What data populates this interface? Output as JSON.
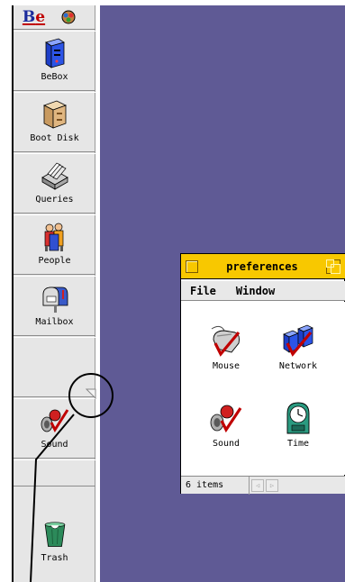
{
  "deskbar": {
    "be_menu": {
      "b": "B",
      "e": "e"
    },
    "items": [
      {
        "label": "BeBox",
        "icon": "bebox-icon"
      },
      {
        "label": "Boot Disk",
        "icon": "boot-disk-icon"
      },
      {
        "label": "Queries",
        "icon": "queries-icon"
      },
      {
        "label": "People",
        "icon": "people-icon"
      },
      {
        "label": "Mailbox",
        "icon": "mailbox-icon"
      },
      {
        "label": "",
        "icon": ""
      },
      {
        "label": "Sound",
        "icon": "sound-icon"
      },
      {
        "label": "",
        "icon": ""
      }
    ],
    "trash": {
      "label": "Trash"
    }
  },
  "prefs_window": {
    "title": "preferences",
    "menu": {
      "file": "File",
      "window": "Window"
    },
    "items": [
      {
        "label": "Mouse",
        "icon": "mouse-icon"
      },
      {
        "label": "Network",
        "icon": "network-icon"
      },
      {
        "label": "Sound",
        "icon": "sound-icon"
      },
      {
        "label": "Time",
        "icon": "time-icon"
      }
    ],
    "status": "6 items",
    "accent": "#f8c800"
  },
  "desktop": {
    "color": "#5f5a95"
  }
}
